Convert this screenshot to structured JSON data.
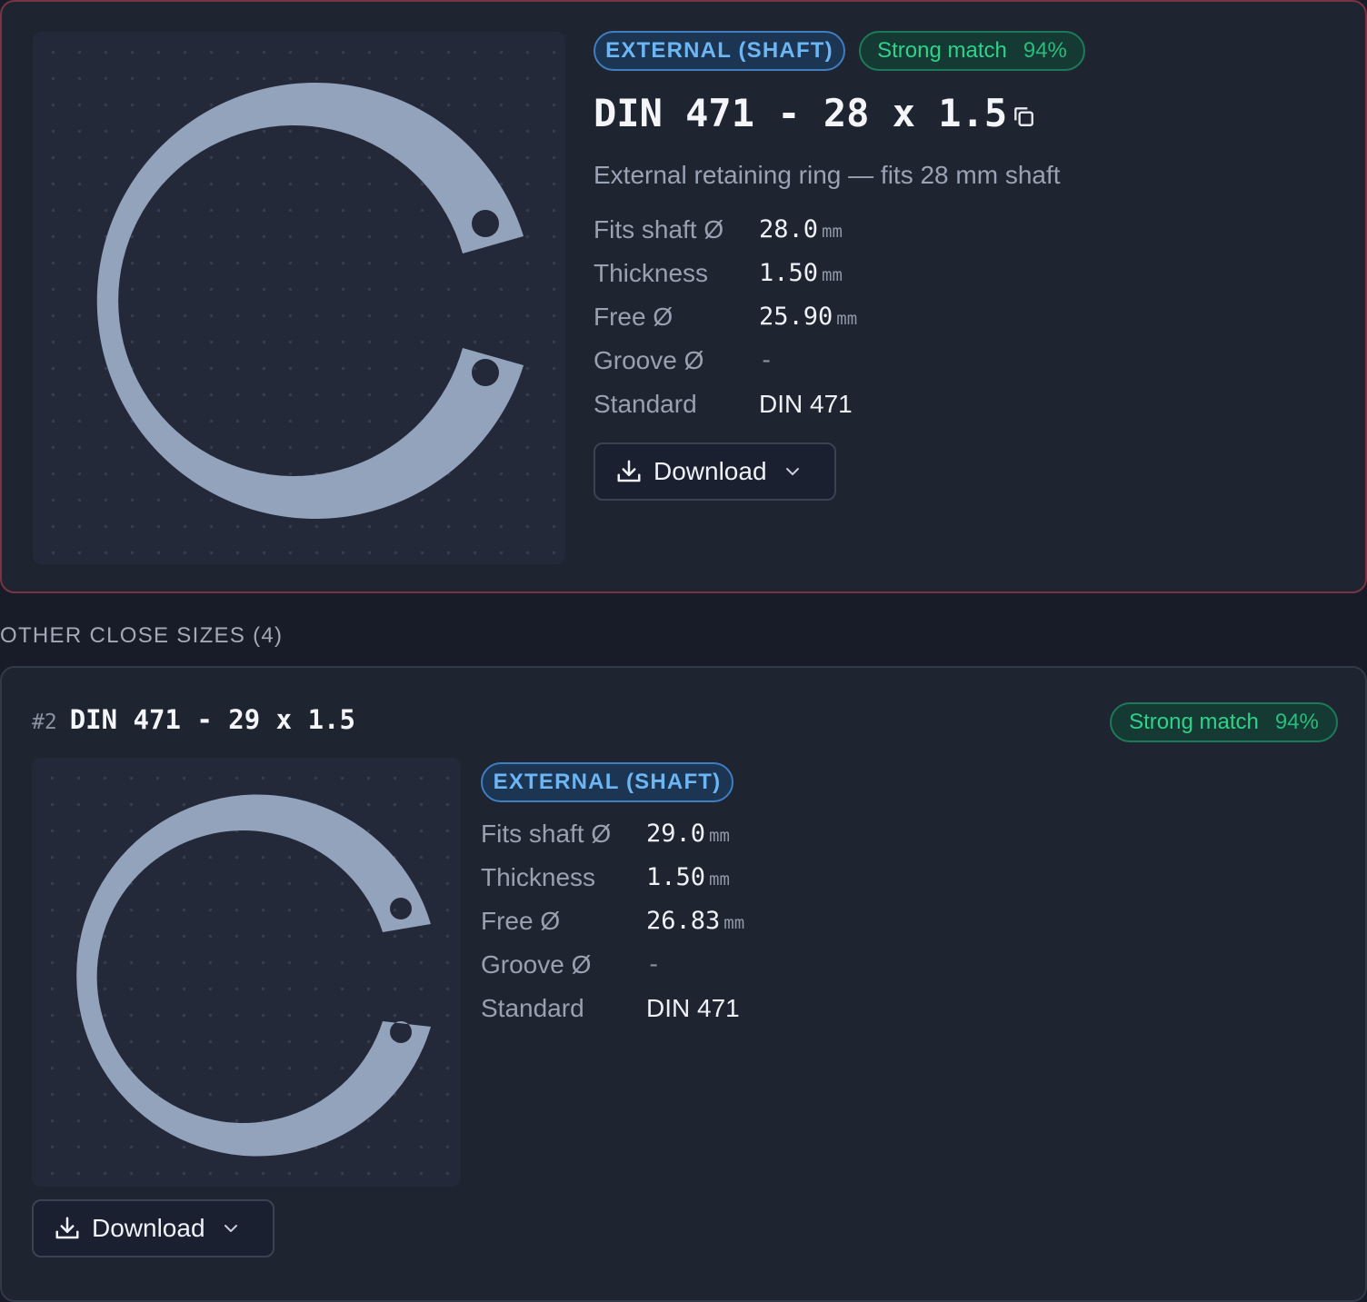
{
  "primary": {
    "type_badge": "EXTERNAL (SHAFT)",
    "match_label": "Strong match",
    "match_pct": "94%",
    "title": "DIN 471 - 28 x 1.5",
    "subtitle": "External retaining ring — fits 28 mm shaft",
    "specs": [
      {
        "label": "Fits shaft Ø",
        "value": "28.0",
        "unit": "mm"
      },
      {
        "label": "Thickness",
        "value": "1.50",
        "unit": "mm"
      },
      {
        "label": "Free Ø",
        "value": "25.90",
        "unit": "mm"
      },
      {
        "label": "Groove Ø",
        "value": "-"
      },
      {
        "label": "Standard",
        "value": "DIN 471"
      }
    ],
    "download_label": "Download"
  },
  "other": {
    "heading": "OTHER CLOSE SIZES (4)",
    "items": [
      {
        "rank": "#2",
        "title": "DIN 471 - 29 x 1.5",
        "type_badge": "EXTERNAL (SHAFT)",
        "match_label": "Strong match",
        "match_pct": "94%",
        "specs": [
          {
            "label": "Fits shaft Ø",
            "value": "29.0",
            "unit": "mm"
          },
          {
            "label": "Thickness",
            "value": "1.50",
            "unit": "mm"
          },
          {
            "label": "Free Ø",
            "value": "26.83",
            "unit": "mm"
          },
          {
            "label": "Groove Ø",
            "value": "-"
          },
          {
            "label": "Standard",
            "value": "DIN 471"
          }
        ],
        "download_label": "Download"
      }
    ]
  },
  "colors": {
    "accent_type": "#6db6f3",
    "accent_match": "#2fd28a",
    "primary_border": "#7a3344",
    "ring_fill": "#93a3bc"
  },
  "icons": [
    "copy-icon",
    "download-icon",
    "chevron-down-icon"
  ]
}
